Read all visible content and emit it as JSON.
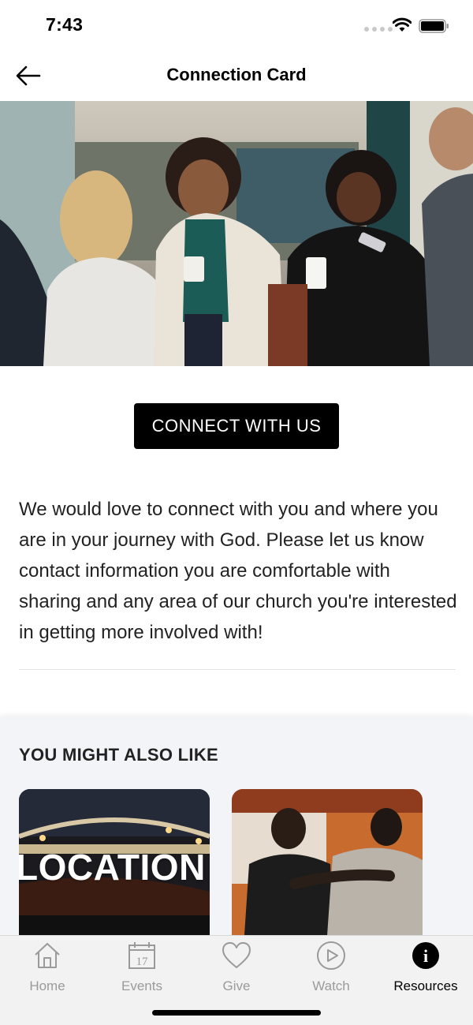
{
  "status_bar": {
    "time": "7:43"
  },
  "header": {
    "title": "Connection Card"
  },
  "cta": {
    "label": "CONNECT WITH US"
  },
  "description": "We would love to connect with you and where you are in your journey with God. Please let us know contact information you are comfortable with sharing and any area of our church you're interested in getting more involved with!",
  "related": {
    "heading": "YOU MIGHT ALSO LIKE",
    "cards": [
      {
        "overlay_text": "LOCATION"
      },
      {
        "overlay_text": ""
      }
    ]
  },
  "tab_bar": {
    "active": "Resources",
    "tabs": [
      {
        "label": "Home",
        "icon": "home-icon"
      },
      {
        "label": "Events",
        "icon": "calendar-icon",
        "icon_text": "17"
      },
      {
        "label": "Give",
        "icon": "heart-icon"
      },
      {
        "label": "Watch",
        "icon": "play-icon"
      },
      {
        "label": "Resources",
        "icon": "info-icon",
        "icon_text": "i"
      }
    ]
  },
  "colors": {
    "accent": "#000000",
    "tab_inactive": "#9a9a9a",
    "section_bg": "#f3f4f8"
  }
}
